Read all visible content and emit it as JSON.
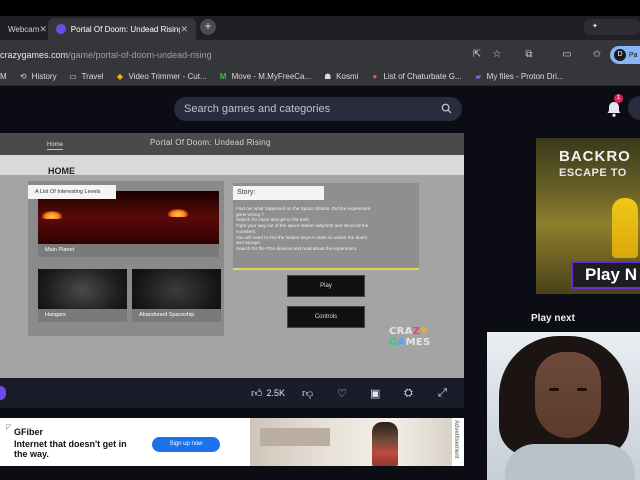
{
  "browser": {
    "tabs": [
      {
        "label": "Webcam"
      },
      {
        "label": "Portal Of Doom: Undead Rising"
      }
    ],
    "new_tab_symbol": "+",
    "close_symbol": "✕",
    "right_tab_label": "",
    "url_host": "crazygames.com",
    "url_path": "/game/portal-of-doom-undead-rising",
    "profile_initial": "D",
    "profile_name": "Pa",
    "bookmarks": [
      {
        "label": "M",
        "icon": "app-icon"
      },
      {
        "label": "History",
        "icon": "history-icon"
      },
      {
        "label": "Travel",
        "icon": "folder-icon"
      },
      {
        "label": "Video Trimmer - Cut...",
        "icon": "video-trimmer-icon"
      },
      {
        "label": "Move - M.MyFreeCa...",
        "icon": "m-icon"
      },
      {
        "label": "Kosmi",
        "icon": "kosmi-icon"
      },
      {
        "label": "List of Chaturbate G...",
        "icon": "list-icon"
      },
      {
        "label": "My files - Proton Dri...",
        "icon": "folder-icon"
      }
    ]
  },
  "site": {
    "search_placeholder": "Search games and categories",
    "notification_count": "1"
  },
  "game": {
    "title": "Portal Of Doom: Undead Rising",
    "home_tab": "Home",
    "home_heading": "HOME",
    "levels_label": "A List Of Interesting Levels",
    "levels": [
      {
        "name": "Main Planet"
      },
      {
        "name": "Hangars"
      },
      {
        "name": "Abandoned Spaceship"
      }
    ],
    "story_title": "Story:",
    "story_lines": [
      "Find out what happened on the Space Station. Did the experiment",
      "gone wrong ?",
      "Search for clues and get to the truth.",
      "Fight your way out of the space station labyrinth and shoot all the",
      "monsters.",
      "You will need to find the hidden keys in order to unlock the doors",
      "and escape.",
      "Search for the PDA devices and read about the experiment."
    ],
    "play_label": "Play",
    "controls_label": "Controls",
    "logo_letters": [
      "C",
      "R",
      "A",
      "Z",
      "Y",
      " ",
      "G",
      "A",
      "M",
      "E",
      "S"
    ]
  },
  "toolbar": {
    "likes": "2.5K"
  },
  "ad": {
    "brand": "GFiber",
    "headline": "Internet that doesn't get in the way.",
    "cta": "Sign up now",
    "side_label": "Advertisement"
  },
  "sidebar": {
    "promo_title_line1": "BACKRO",
    "promo_title_line2": "ESCAPE TO",
    "promo_play": "Play N",
    "play_next": "Play next"
  },
  "colors": {
    "site_bg": "#0c0d14",
    "accent_purple": "#6c4cf0",
    "ad_cta_blue": "#1a73e8"
  }
}
